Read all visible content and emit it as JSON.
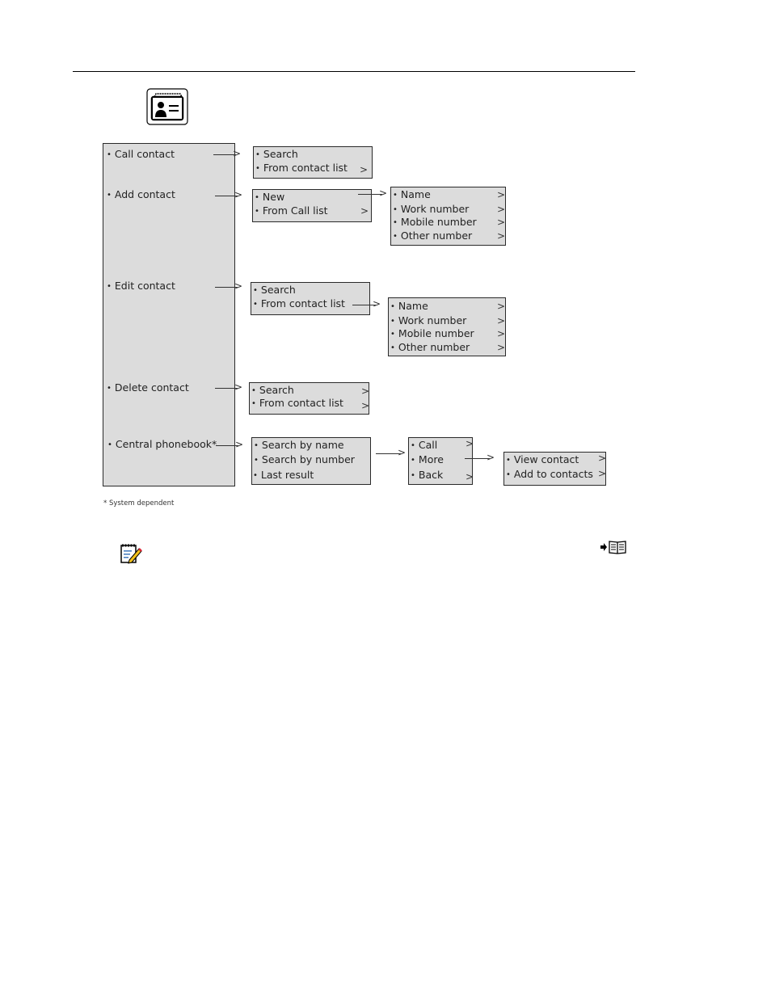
{
  "header": {
    "icon": "contacts-card-icon"
  },
  "main_menu": {
    "items": [
      {
        "label": "Call contact"
      },
      {
        "label": "Add contact"
      },
      {
        "label": "Edit contact"
      },
      {
        "label": "Delete contact"
      },
      {
        "label": "Central phonebook*"
      }
    ]
  },
  "submenus": {
    "call": [
      "Search",
      "From contact list"
    ],
    "add": [
      "New",
      "From Call list"
    ],
    "add_new": [
      "Name",
      "Work number",
      "Mobile number",
      "Other number"
    ],
    "edit": [
      "Search",
      "From contact list"
    ],
    "edit_from_list": [
      "Name",
      "Work number",
      "Mobile number",
      "Other number"
    ],
    "delete": [
      "Search",
      "From contact list"
    ],
    "central": [
      "Search by name",
      "Search by number",
      "Last result"
    ],
    "central_result": [
      "Call",
      "More",
      "Back"
    ],
    "central_more": [
      "View contact",
      "Add to contacts"
    ]
  },
  "glyphs": {
    "bullet": "•",
    "chevron": ">"
  },
  "footnote": "* System dependent",
  "icons": {
    "note": "note-pencil-icon",
    "reference": "book-reference-icon"
  }
}
